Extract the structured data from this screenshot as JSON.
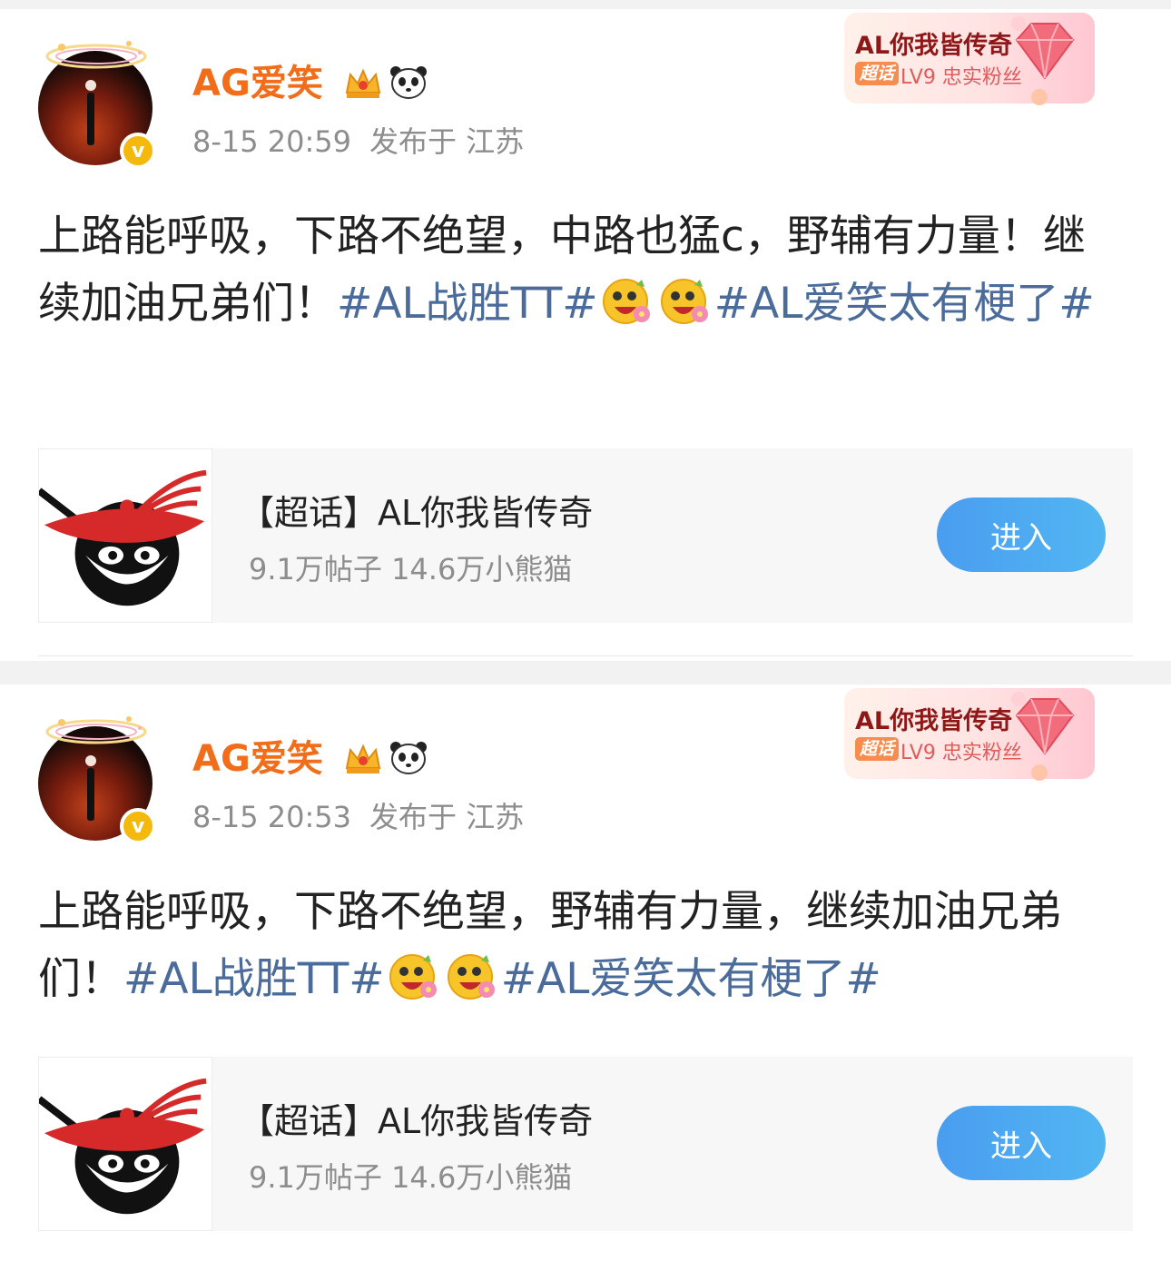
{
  "colors": {
    "username": "#f26d1a",
    "topic_link": "#4b6c9b",
    "meta": "#8d8d8d",
    "button": "#4a9df0",
    "verified_badge": "#f5b80c"
  },
  "icons": {
    "verified": "v-badge-icon",
    "crown": "crown-icon",
    "panda": "panda-icon",
    "emoji": "happy-flower-emoji-icon",
    "gem": "gem-icon"
  },
  "posts": [
    {
      "username": "AG爱笑",
      "verified_mark": "v",
      "time": "8-15 20:59",
      "location": "发布于 江苏",
      "fan_badge": {
        "title": "AL你我皆传奇",
        "tag": "超话",
        "level": "LV9 忠实粉丝"
      },
      "content": {
        "text1": "上路能呼吸，下路不绝望，中路也猛c，野辅有力量！继续加油兄弟们！",
        "topic1": "#AL战胜TT#",
        "topic2": "#AL爱笑太有梗了#"
      },
      "card": {
        "title": "【超话】AL你我皆传奇",
        "stats": "9.1万帖子 14.6万小熊猫",
        "button": "进入"
      }
    },
    {
      "username": "AG爱笑",
      "verified_mark": "v",
      "time": "8-15 20:53",
      "location": "发布于 江苏",
      "fan_badge": {
        "title": "AL你我皆传奇",
        "tag": "超话",
        "level": "LV9 忠实粉丝"
      },
      "content": {
        "text1": "上路能呼吸，下路不绝望，野辅有力量，继续加油兄弟们！",
        "topic1": "#AL战胜TT#",
        "topic2": "#AL爱笑太有梗了#"
      },
      "card": {
        "title": "【超话】AL你我皆传奇",
        "stats": "9.1万帖子 14.6万小熊猫",
        "button": "进入"
      }
    }
  ]
}
